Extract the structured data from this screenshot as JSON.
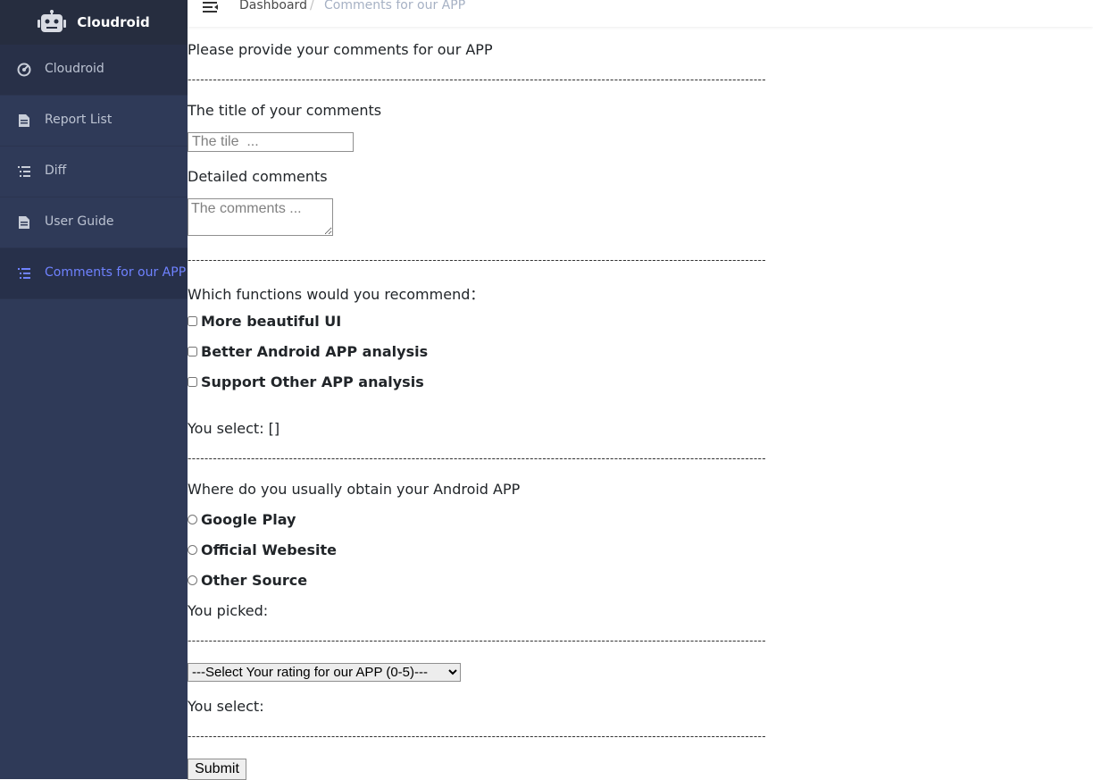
{
  "sidebar": {
    "brand": "Cloudroid",
    "items": [
      {
        "label": "Cloudroid",
        "icon": "dashboard-icon"
      },
      {
        "label": "Report List",
        "icon": "document-icon"
      },
      {
        "label": "Diff",
        "icon": "list-icon"
      },
      {
        "label": "User Guide",
        "icon": "document-icon"
      },
      {
        "label": "Comments for our APP",
        "icon": "list-icon",
        "active": true
      }
    ]
  },
  "header": {
    "breadcrumb": {
      "home": "Dashboard",
      "separator": "/",
      "current": "Comments for our APP"
    }
  },
  "form": {
    "intro": "Please provide your comments for our APP",
    "divider": "-----------------------------------------------------------------------------------------------------------------------------------------",
    "title_label": "The title of your comments",
    "title_placeholder": "The tile  ...",
    "detail_label": "Detailed comments",
    "detail_placeholder": "The comments ...",
    "functions_question": "Which functions would you recommend：",
    "functions": [
      "More beautiful UI",
      "Better Android APP analysis",
      "Support Other APP analysis"
    ],
    "functions_result": "You select: []",
    "source_question": "Where do you usually obtain your Android APP",
    "sources": [
      "Google Play",
      "Official Webesite",
      "Other Source"
    ],
    "source_result": "You picked:",
    "rating_placeholder": "---Select Your rating for our APP (0-5)---",
    "rating_result": "You select:",
    "submit_label": "Submit"
  },
  "colors": {
    "sidebar_bg": "#2f3a58",
    "brand_bg": "#262d3f",
    "active_text": "#6f82ff"
  }
}
